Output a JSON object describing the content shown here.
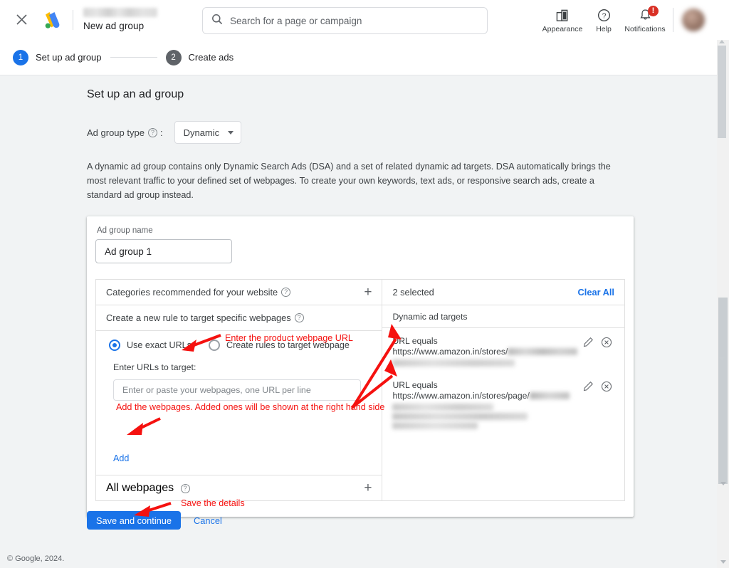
{
  "topbar": {
    "close_icon": "close-icon",
    "logo": "google-ads-logo",
    "account_name_redacted": "",
    "title": "New ad group",
    "search": {
      "placeholder": "Search for a page or campaign",
      "icon": "search-icon"
    },
    "actions": [
      {
        "label": "Appearance",
        "icon": "appearance-icon"
      },
      {
        "label": "Help",
        "icon": "help-icon"
      },
      {
        "label": "Notifications",
        "icon": "bell-icon",
        "badge": "!"
      }
    ]
  },
  "stepper": {
    "steps": [
      {
        "num": "1",
        "label": "Set up ad group",
        "state": "active"
      },
      {
        "num": "2",
        "label": "Create ads",
        "state": "inactive"
      }
    ]
  },
  "main": {
    "page_title": "Set up an ad group",
    "ad_group_type": {
      "label": "Ad group type",
      "help_icon": "help-circle-icon",
      "colon": ":",
      "selected": "Dynamic"
    },
    "description": "A dynamic ad group contains only Dynamic Search Ads (DSA) and a set of related dynamic ad targets. DSA automatically brings the most relevant traffic to your defined set of webpages. To create your own keywords, text ads, or responsive search ads, create a standard ad group instead.",
    "ad_group_name": {
      "label": "Ad group name",
      "value": "Ad group 1"
    },
    "left_panel": {
      "categories_row": {
        "label": "Categories recommended for your website",
        "help_icon": "help-circle-icon",
        "add_icon": "plus-icon"
      },
      "rule_row": {
        "label": "Create a new rule to target specific webpages",
        "help_icon": "help-circle-icon"
      },
      "radios": [
        {
          "label": "Use exact URLs",
          "selected": true
        },
        {
          "label": "Create rules to target webpage",
          "selected": false
        }
      ],
      "urls_label": "Enter URLs to target:",
      "urls_placeholder": "Enter or paste your webpages, one URL per line",
      "add_link": "Add",
      "all_webpages_row": {
        "label": "All webpages",
        "help_icon": "help-circle-icon",
        "add_icon": "plus-icon"
      }
    },
    "right_panel": {
      "selected_count": "2 selected",
      "clear_all": "Clear All",
      "column_header": "Dynamic ad targets",
      "targets": [
        {
          "match": "URL equals",
          "url": "https://www.amazon.in/stores/",
          "redacted": true,
          "edit_icon": "pencil-icon",
          "remove_icon": "remove-circle-icon"
        },
        {
          "match": "URL equals",
          "url": "https://www.amazon.in/stores/page/",
          "redacted": true,
          "edit_icon": "pencil-icon",
          "remove_icon": "remove-circle-icon"
        }
      ]
    },
    "buttons": {
      "primary": "Save and continue",
      "secondary": "Cancel"
    }
  },
  "footer": {
    "copyright": "© Google, 2024."
  },
  "annotations": [
    {
      "id": "anno-url-input",
      "text": "Enter the product webpage URL"
    },
    {
      "id": "anno-add",
      "text": "Add the webpages. Added ones will be shown at the right hand side"
    },
    {
      "id": "anno-save",
      "text": "Save the details"
    }
  ],
  "colors": {
    "accent_blue": "#1a73e8",
    "annotation_red": "#f5110f",
    "page_bg": "#f1f3f4",
    "badge_red": "#d93025"
  }
}
